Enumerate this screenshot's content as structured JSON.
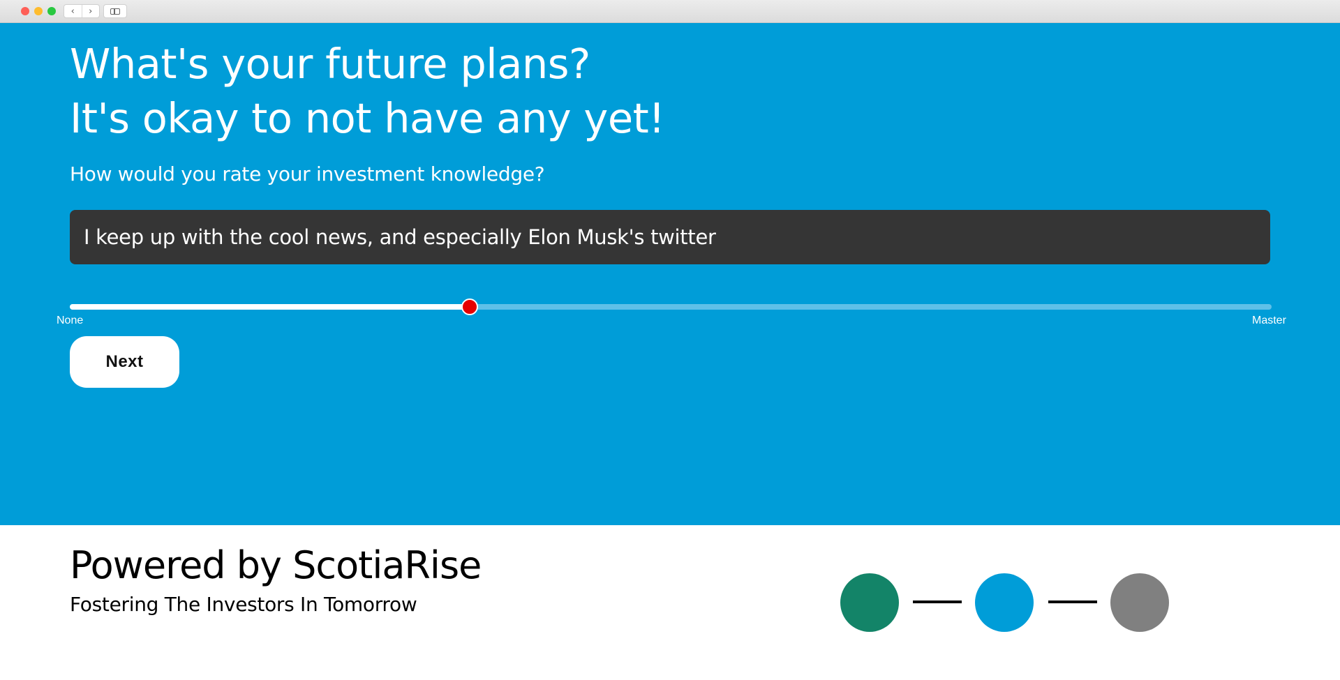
{
  "window": {
    "traffic_lights": [
      "close",
      "minimize",
      "zoom"
    ],
    "back_icon": "‹",
    "forward_icon": "›"
  },
  "colors": {
    "hero_background": "#009dd8",
    "answer_background": "#353535",
    "slider_thumb": "#e60000",
    "step_complete": "#138468",
    "step_current": "#009dd8",
    "step_pending": "#808080"
  },
  "hero": {
    "headline_line1": "What's your future plans?",
    "headline_line2": "It's okay to not have any yet!",
    "question": "How would you rate your investment knowledge?",
    "answer": "I keep up with the cool news, and especially Elon Musk's twitter"
  },
  "slider": {
    "min_label": "None",
    "max_label": "Master",
    "value_fraction": 0.333
  },
  "next_button": {
    "label": "Next"
  },
  "footer": {
    "title": "Powered by ScotiaRise",
    "tagline": "Fostering The Investors In Tomorrow"
  },
  "progress": {
    "steps": [
      {
        "status": "complete",
        "color": "#138468"
      },
      {
        "status": "current",
        "color": "#009dd8"
      },
      {
        "status": "pending",
        "color": "#808080"
      }
    ]
  }
}
